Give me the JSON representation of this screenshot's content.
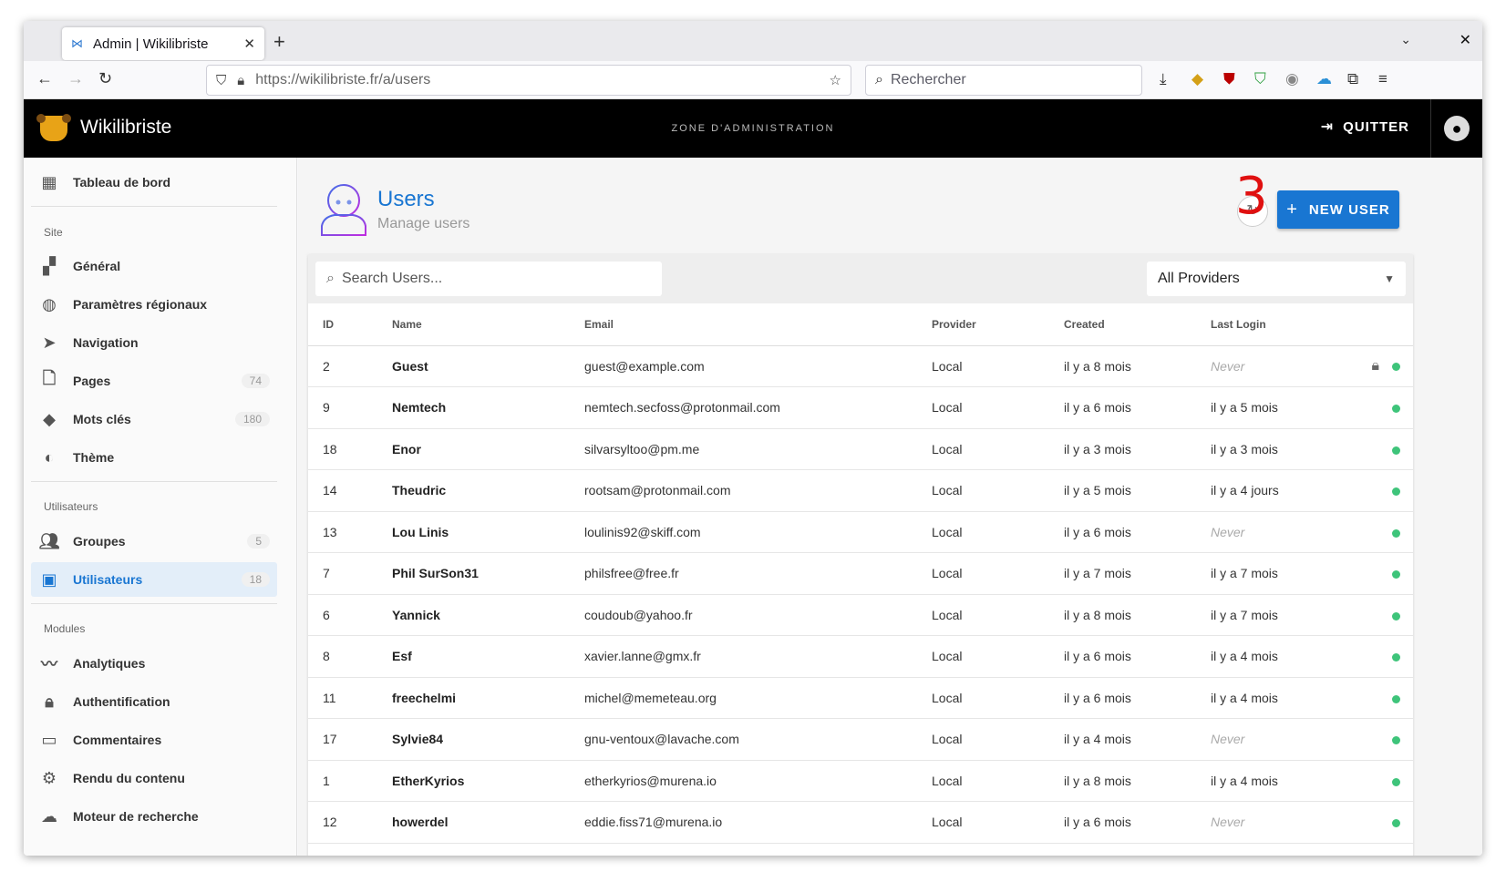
{
  "browser": {
    "tab_title": "Admin | Wikilibriste",
    "url_host": "https://wikilibriste.fr",
    "url_path": "/a/users",
    "search_placeholder": "Rechercher"
  },
  "app": {
    "title": "Wikilibriste",
    "zone": "ZONE D'ADMINISTRATION",
    "quit_label": "QUITTER"
  },
  "sidebar": {
    "items": [
      {
        "label": "Tableau de bord",
        "icon": "dashboard-icon"
      },
      {
        "label": "Général",
        "icon": "widgets-icon"
      },
      {
        "label": "Paramètres régionaux",
        "icon": "globe-icon"
      },
      {
        "label": "Navigation",
        "icon": "navigation-icon"
      },
      {
        "label": "Pages",
        "icon": "page-icon",
        "count": "74"
      },
      {
        "label": "Mots clés",
        "icon": "tags-icon",
        "count": "180"
      },
      {
        "label": "Thème",
        "icon": "palette-icon"
      },
      {
        "label": "Groupes",
        "icon": "groups-icon",
        "count": "5"
      },
      {
        "label": "Utilisateurs",
        "icon": "user-box-icon",
        "count": "18"
      },
      {
        "label": "Analytiques",
        "icon": "analytics-icon"
      },
      {
        "label": "Authentification",
        "icon": "lock-icon"
      },
      {
        "label": "Commentaires",
        "icon": "comments-icon"
      },
      {
        "label": "Rendu du contenu",
        "icon": "gears-icon"
      },
      {
        "label": "Moteur de recherche",
        "icon": "search-cloud-icon"
      }
    ],
    "headers": {
      "site": "Site",
      "users": "Utilisateurs",
      "modules": "Modules"
    }
  },
  "main": {
    "title": "Users",
    "subtitle": "Manage users",
    "annotation": "3",
    "new_user_label": "NEW USER",
    "search_placeholder": "Search Users...",
    "provider_filter": "All Providers",
    "columns": [
      "ID",
      "Name",
      "Email",
      "Provider",
      "Created",
      "Last Login"
    ],
    "rows": [
      {
        "id": "2",
        "name": "Guest",
        "email": "guest@example.com",
        "provider": "Local",
        "created": "il y a 8 mois",
        "last": "Never",
        "locked": true
      },
      {
        "id": "9",
        "name": "Nemtech",
        "email": "nemtech.secfoss@protonmail.com",
        "provider": "Local",
        "created": "il y a 6 mois",
        "last": "il y a 5 mois"
      },
      {
        "id": "18",
        "name": "Enor",
        "email": "silvarsyltoo@pm.me",
        "provider": "Local",
        "created": "il y a 3 mois",
        "last": "il y a 3 mois"
      },
      {
        "id": "14",
        "name": "Theudric",
        "email": "rootsam@protonmail.com",
        "provider": "Local",
        "created": "il y a 5 mois",
        "last": "il y a 4 jours"
      },
      {
        "id": "13",
        "name": "Lou Linis",
        "email": "loulinis92@skiff.com",
        "provider": "Local",
        "created": "il y a 6 mois",
        "last": "Never"
      },
      {
        "id": "7",
        "name": "Phil SurSon31",
        "email": "philsfree@free.fr",
        "provider": "Local",
        "created": "il y a 7 mois",
        "last": "il y a 7 mois"
      },
      {
        "id": "6",
        "name": "Yannick",
        "email": "coudoub@yahoo.fr",
        "provider": "Local",
        "created": "il y a 8 mois",
        "last": "il y a 7 mois"
      },
      {
        "id": "8",
        "name": "Esf",
        "email": "xavier.lanne@gmx.fr",
        "provider": "Local",
        "created": "il y a 6 mois",
        "last": "il y a 4 mois"
      },
      {
        "id": "11",
        "name": "freechelmi",
        "email": "michel@memeteau.org",
        "provider": "Local",
        "created": "il y a 6 mois",
        "last": "il y a 4 mois"
      },
      {
        "id": "17",
        "name": "Sylvie84",
        "email": "gnu-ventoux@lavache.com",
        "provider": "Local",
        "created": "il y a 4 mois",
        "last": "Never"
      },
      {
        "id": "1",
        "name": "EtherKyrios",
        "email": "etherkyrios@murena.io",
        "provider": "Local",
        "created": "il y a 8 mois",
        "last": "il y a 4 mois"
      },
      {
        "id": "12",
        "name": "howerdel",
        "email": "eddie.fiss71@murena.io",
        "provider": "Local",
        "created": "il y a 6 mois",
        "last": "Never"
      }
    ]
  },
  "colors": {
    "accent": "#1976d2",
    "status_active": "#3ec47a",
    "annotation": "#e01010"
  }
}
